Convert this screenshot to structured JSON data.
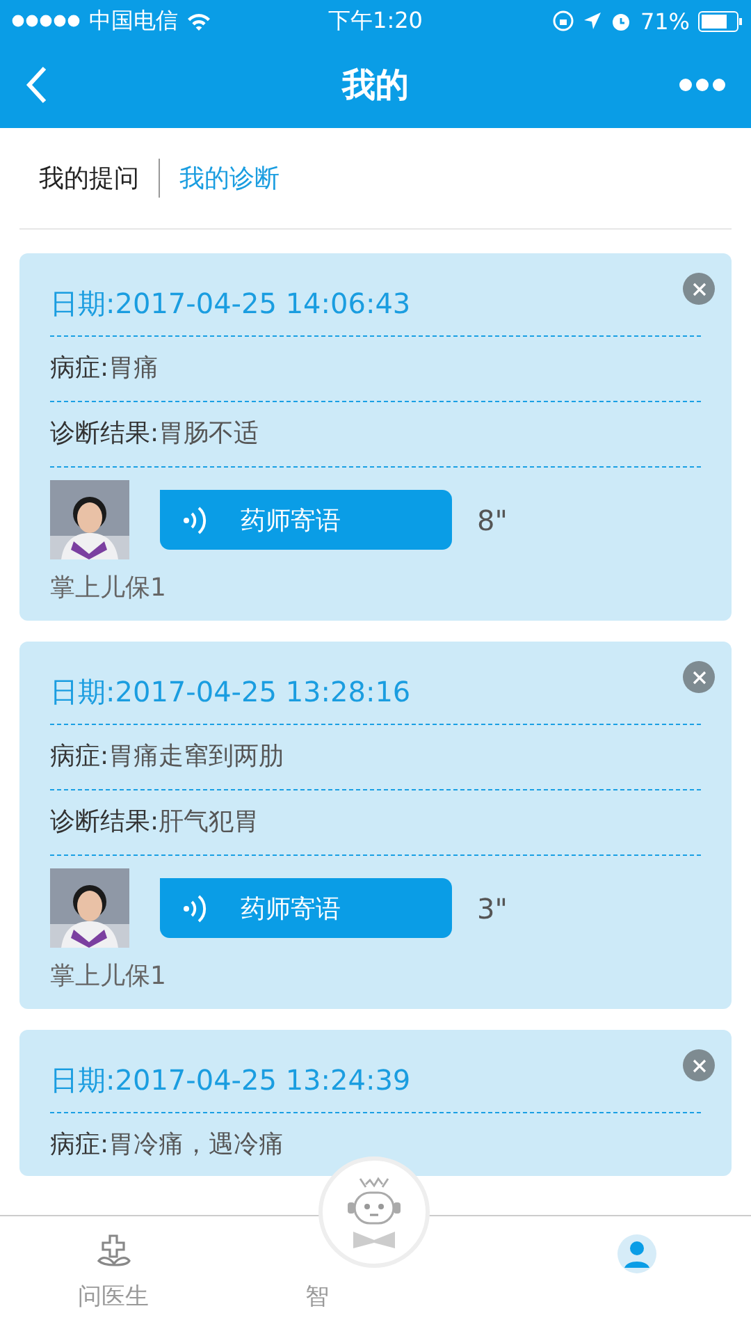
{
  "status_bar": {
    "carrier": "中国电信",
    "time": "下午1:20",
    "battery": "71%"
  },
  "nav": {
    "title": "我的"
  },
  "segments": [
    {
      "label": "我的提问",
      "selected": false
    },
    {
      "label": "我的诊断",
      "selected": true
    }
  ],
  "records": [
    {
      "date": "日期:2017-04-25 14:06:43",
      "symptom_label": "病症:",
      "symptom": "胃痛",
      "result_label": "诊断结果:",
      "result": "胃肠不适",
      "voice_label": "药师寄语",
      "duration": "8\"",
      "author": "掌上儿保1"
    },
    {
      "date": "日期:2017-04-25 13:28:16",
      "symptom_label": "病症:",
      "symptom": "胃痛走窜到两肋",
      "result_label": "诊断结果:",
      "result": "肝气犯胃",
      "voice_label": "药师寄语",
      "duration": "3\"",
      "author": "掌上儿保1"
    },
    {
      "date": "日期:2017-04-25 13:24:39",
      "symptom_label": "病症:",
      "symptom": "胃冷痛，遇冷痛"
    }
  ],
  "tab_bar": [
    {
      "label": "问医生",
      "kind": "doctor",
      "selected": false
    },
    {
      "label": "智",
      "kind": "robot",
      "selected": false
    },
    {
      "kind": "me",
      "selected": true
    }
  ]
}
